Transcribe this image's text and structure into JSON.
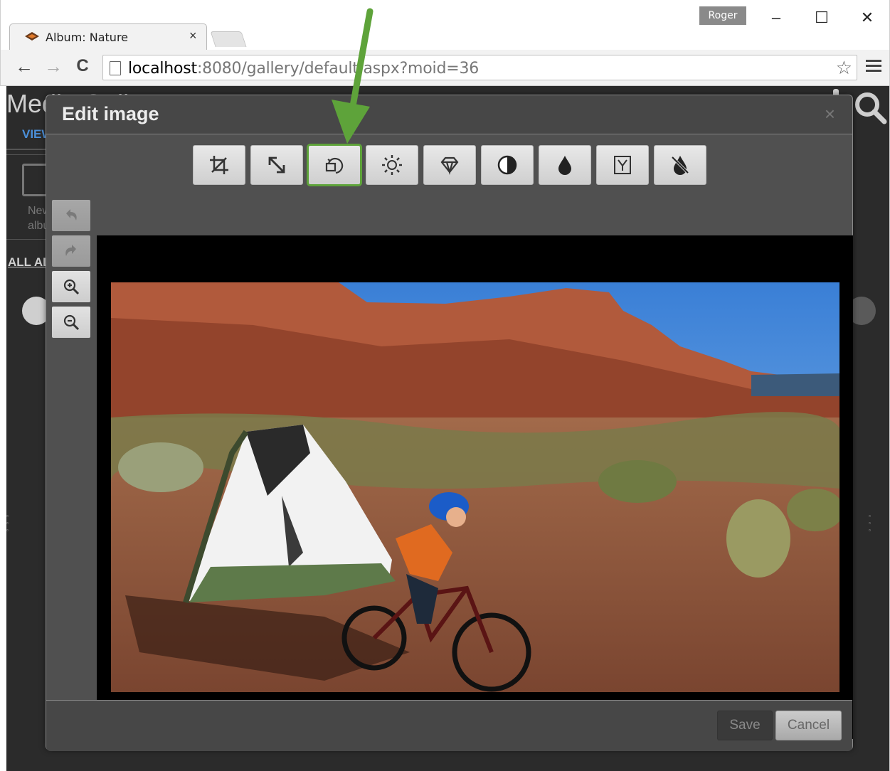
{
  "browser": {
    "tab_title": "Album: Nature",
    "tab_close": "×",
    "profile_name": "Roger",
    "minimize": "–",
    "maximize": "☐",
    "close": "✕",
    "back": "←",
    "forward": "→",
    "reload": "C",
    "url_host": "localhost",
    "url_rest": ":8080/gallery/default.aspx?moid=36",
    "star": "☆"
  },
  "page": {
    "title": "Media Gallery",
    "view_link": "VIEW",
    "new_album_label": "New album",
    "all_albums": "ALL ALBUMS"
  },
  "modal": {
    "title": "Edit image",
    "close": "×",
    "tools": [
      {
        "name": "crop",
        "icon": "crop-icon"
      },
      {
        "name": "resize",
        "icon": "resize-icon"
      },
      {
        "name": "rotate",
        "icon": "rotate-icon",
        "highlighted": true
      },
      {
        "name": "brightness",
        "icon": "sun-icon"
      },
      {
        "name": "sharpen",
        "icon": "diamond-icon"
      },
      {
        "name": "contrast",
        "icon": "contrast-icon"
      },
      {
        "name": "saturation",
        "icon": "drop-icon"
      },
      {
        "name": "gamma",
        "icon": "gamma-icon",
        "glyph": "Y"
      },
      {
        "name": "grayscale",
        "icon": "no-color-icon"
      }
    ],
    "side_tools": [
      {
        "name": "undo",
        "icon": "undo-icon"
      },
      {
        "name": "redo",
        "icon": "redo-icon"
      },
      {
        "name": "zoom_in",
        "icon": "zoom-in-icon"
      },
      {
        "name": "zoom_out",
        "icon": "zoom-out-icon"
      }
    ],
    "save_label": "Save",
    "cancel_label": "Cancel"
  },
  "colors": {
    "highlight": "#5ea33a",
    "annotation_arrow": "#5ea33a",
    "link": "#4b8fd8"
  }
}
